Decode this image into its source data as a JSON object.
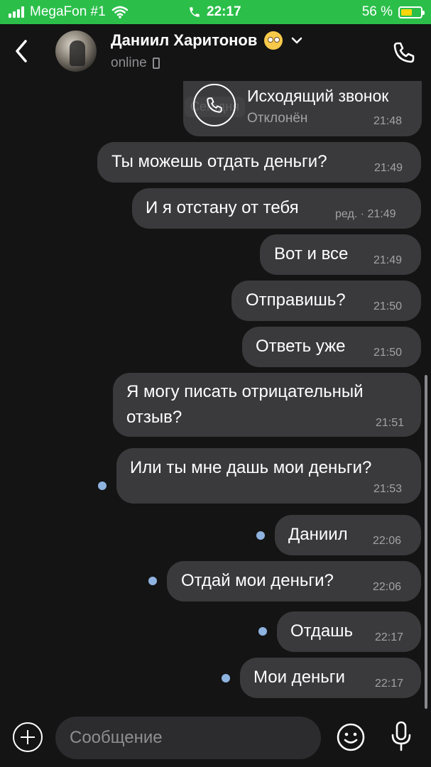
{
  "status_bar": {
    "carrier": "MegaFon #1",
    "time": "22:17",
    "battery_pct": "56 %",
    "battery_level": 0.56,
    "icons": [
      "signal-icon",
      "wifi-icon",
      "call-active-icon",
      "battery-icon"
    ],
    "background": "#2bbf4a"
  },
  "header": {
    "name": "Даниил Харитонов",
    "status": "online",
    "icons": [
      "back-icon",
      "avatar",
      "eyeroll-emoji-icon",
      "chevron-down-icon",
      "mobile-icon",
      "phone-icon"
    ]
  },
  "messages": [
    {
      "type": "call",
      "title": "Исходящий звонок",
      "subtitle": "Отклонён",
      "time": "21:48",
      "overlay_label": "Сегодня"
    },
    {
      "text": "Ты можешь отдать деньги?",
      "time": "21:49",
      "unread": false
    },
    {
      "text": "И я отстану от тебя",
      "meta": "ред. · 21:49",
      "unread": false
    },
    {
      "text": "Вот и все",
      "time": "21:49",
      "unread": false
    },
    {
      "text": "Отправишь?",
      "time": "21:50",
      "unread": false
    },
    {
      "text": "Ответь уже",
      "time": "21:50",
      "unread": false
    },
    {
      "text_lines": [
        "Я могу писать отрицательный",
        "отзыв?"
      ],
      "time": "21:51",
      "unread": false
    },
    {
      "text": "Или ты мне дашь мои деньги?",
      "time": "21:53",
      "unread": true
    },
    {
      "text": "Даниил",
      "time": "22:06",
      "unread": true
    },
    {
      "text": "Отдай мои деньги?",
      "time": "22:06",
      "unread": true
    },
    {
      "text": "Отдашь",
      "time": "22:17",
      "unread": true
    },
    {
      "text": "Мои деньги",
      "time": "22:17",
      "unread": true
    }
  ],
  "input": {
    "placeholder": "Сообщение",
    "value": "",
    "icons": [
      "plus-icon",
      "smile-icon",
      "microphone-icon"
    ]
  },
  "colors": {
    "background": "#141414",
    "bubble": "#3a3a3c",
    "unread_dot": "#8fb3e0",
    "timestamp": "#a2a2a7"
  }
}
